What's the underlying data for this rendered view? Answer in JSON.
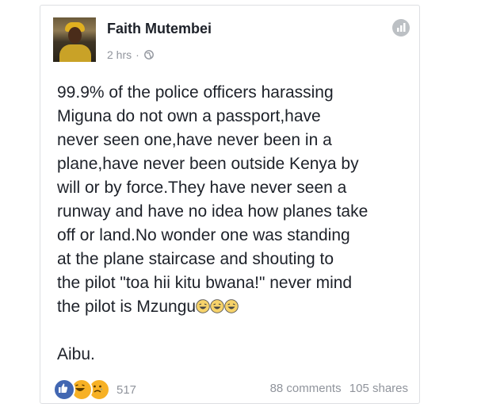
{
  "post": {
    "author_name": "Faith Mutembei",
    "time": "2 hrs",
    "separator": "·",
    "privacy_icon": "globe-icon",
    "header_icon": "chart-icon",
    "lines": [
      "99.9% of the police officers harassing",
      "Miguna do not own a passport,have",
      "never seen one,have never been in a",
      "plane,have never been outside Kenya by",
      "will or by force.They have never seen a",
      "runway and have no idea how planes take",
      "off or land.No wonder one was standing",
      "at the plane staircase  and shouting to",
      "the pilot \"toa hii kitu bwana!\" never mind",
      "the pilot is Mzungu"
    ],
    "closing": "Aibu."
  },
  "footer": {
    "reaction_icons": [
      "like-icon",
      "haha-icon",
      "sad-icon"
    ],
    "reaction_count": "517",
    "comments": "88 comments",
    "shares": "105 shares"
  },
  "colors": {
    "text": "#1d2129",
    "meta": "#90949c",
    "like": "#4267b2",
    "emoji": "#f7b125",
    "border": "#dddfe2"
  }
}
